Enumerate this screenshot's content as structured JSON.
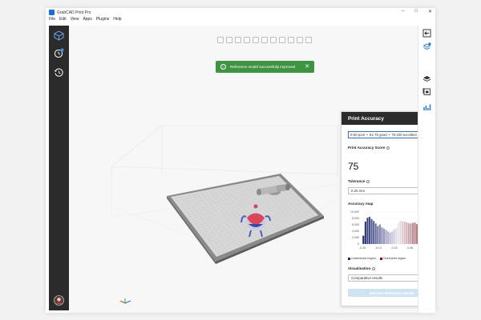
{
  "app": {
    "title": "GrabCAD Print Pro",
    "window_controls": {
      "minimize": "–",
      "maximize": "□",
      "close": "✕"
    }
  },
  "menu": [
    "File",
    "Edit",
    "View",
    "Apps",
    "Plugins",
    "Help"
  ],
  "toast": {
    "message": "Reference model successfully improved",
    "check": "✓",
    "close": "✕"
  },
  "sidebar_left": {
    "icons": [
      "model-view-icon",
      "history-badge-icon",
      "history-icon",
      "avatar-icon"
    ],
    "badge": "2"
  },
  "sidebar_right": {
    "icons": [
      "exit-panel-icon",
      "layers-settings-icon",
      "stack-icon",
      "report-icon",
      "bar-chart-icon"
    ]
  },
  "panel": {
    "title": "Print Accuracy",
    "legend": [
      "0-50 poor",
      "51-75 good",
      "76-100 excellent"
    ],
    "score_label": "Print Accuracy Score",
    "score": "75",
    "tolerance_label": "Tolerance",
    "tolerance_value": "0.25 mm",
    "map_label": "Accuracy map",
    "undersized_label": "Undersized region",
    "oversized_label": "Oversized region",
    "visualisation_label": "Visualisation",
    "visualisation_value": "Comparative results",
    "button_label": "Improve Reference Model"
  },
  "colors": {
    "undersized": "#1e2a6e",
    "oversized": "#7a1010",
    "toast_bg": "#3f9443",
    "accent": "#1c6fd1"
  },
  "chart_data": {
    "type": "bar",
    "yticks": [
      "10,000",
      "8,000",
      "6,000",
      "4,000",
      "2,000",
      "0"
    ],
    "xticks": [
      "-0.25",
      "-0.14",
      "-0.03",
      "0.08",
      "0.19"
    ],
    "ylim": [
      0,
      10000
    ],
    "xlim": [
      -0.25,
      0.25
    ],
    "values": [
      2600,
      7000,
      8200,
      8500,
      7800,
      7200,
      6400,
      5600,
      6100,
      5200,
      4800,
      4400,
      3900,
      3600,
      3900,
      4600,
      5000,
      6600,
      7300,
      7100,
      7000,
      6800,
      6500,
      6400,
      6600,
      6700,
      6200,
      5800,
      5400,
      6300,
      7000,
      6900,
      5600,
      4800,
      3900
    ]
  }
}
